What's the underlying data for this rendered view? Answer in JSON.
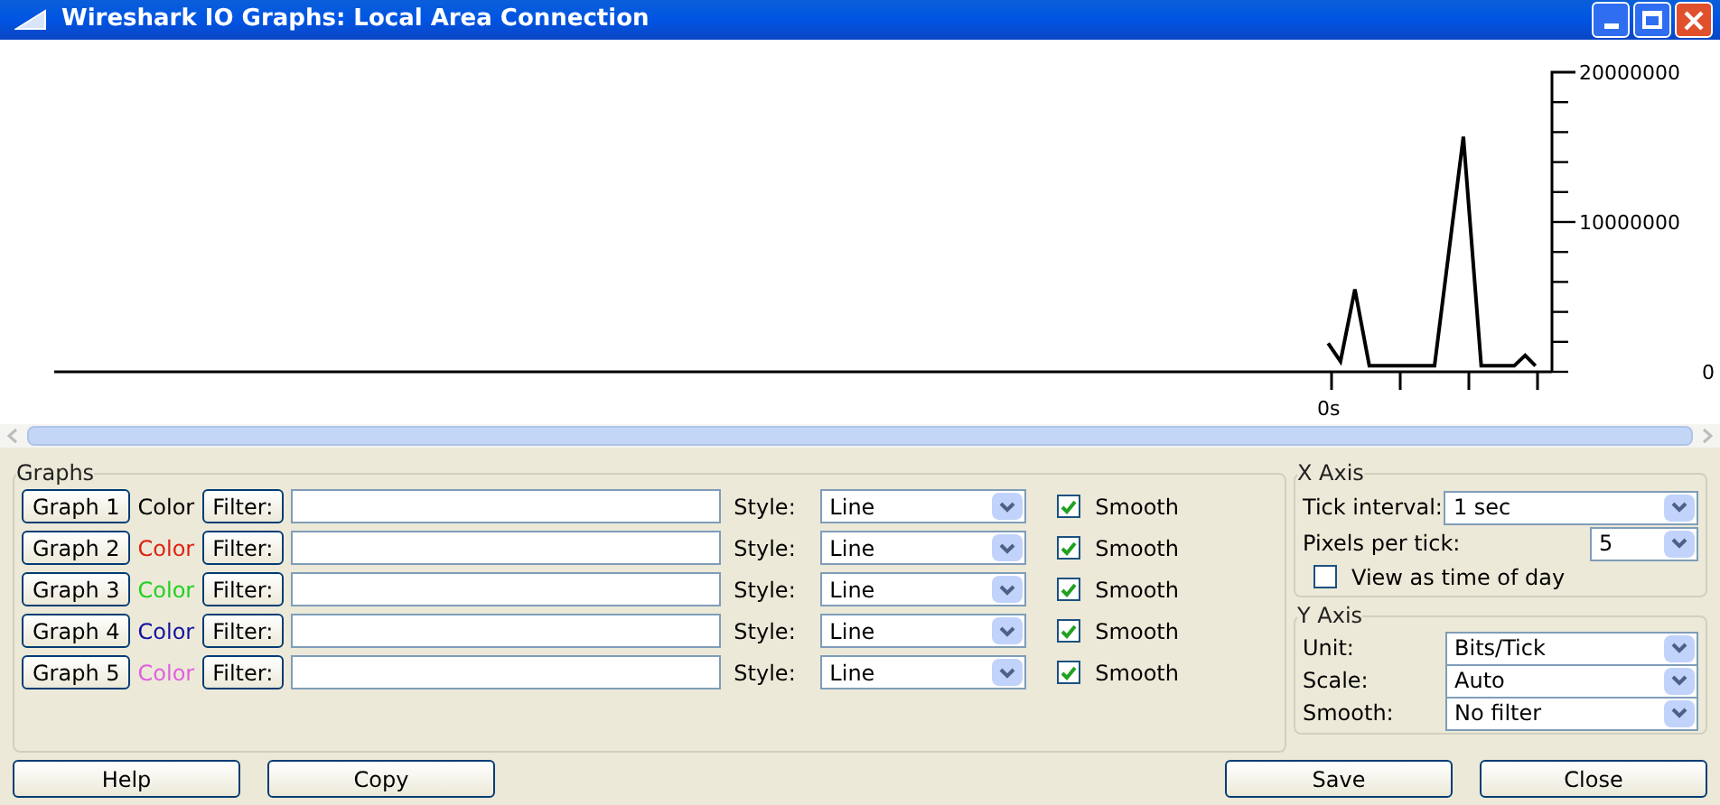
{
  "window": {
    "title": "Wireshark IO Graphs: Local Area Connection"
  },
  "graph": {
    "y_labels": [
      "20000000",
      "10000000",
      "0"
    ],
    "x_label": "0s"
  },
  "graphs": {
    "title": "Graphs",
    "rows": [
      {
        "button": "Graph 1",
        "color_label": "Color",
        "color": "#000000",
        "filter_button": "Filter:",
        "style_label": "Style:",
        "style": "Line",
        "smooth_label": "Smooth",
        "smooth": true
      },
      {
        "button": "Graph 2",
        "color_label": "Color",
        "color": "#e02010",
        "filter_button": "Filter:",
        "style_label": "Style:",
        "style": "Line",
        "smooth_label": "Smooth",
        "smooth": true
      },
      {
        "button": "Graph 3",
        "color_label": "Color",
        "color": "#20d020",
        "filter_button": "Filter:",
        "style_label": "Style:",
        "style": "Line",
        "smooth_label": "Smooth",
        "smooth": true
      },
      {
        "button": "Graph 4",
        "color_label": "Color",
        "color": "#1010a0",
        "filter_button": "Filter:",
        "style_label": "Style:",
        "style": "Line",
        "smooth_label": "Smooth",
        "smooth": true
      },
      {
        "button": "Graph 5",
        "color_label": "Color",
        "color": "#e060e0",
        "filter_button": "Filter:",
        "style_label": "Style:",
        "style": "Line",
        "smooth_label": "Smooth",
        "smooth": true
      }
    ]
  },
  "x_axis": {
    "title": "X Axis",
    "tick_interval_label": "Tick interval:",
    "tick_interval": "1 sec",
    "pixels_per_tick_label": "Pixels per tick:",
    "pixels_per_tick": "5",
    "time_of_day": {
      "label": "View as time of day",
      "checked": false
    }
  },
  "y_axis": {
    "title": "Y Axis",
    "fields": [
      {
        "label": "Unit:",
        "value": "Bits/Tick"
      },
      {
        "label": "Scale:",
        "value": "Auto"
      },
      {
        "label": "Smooth:",
        "value": "No filter"
      }
    ]
  },
  "buttons": [
    {
      "label": "Help"
    },
    {
      "label": "Copy"
    },
    {
      "label": "Save"
    },
    {
      "label": "Close"
    }
  ]
}
